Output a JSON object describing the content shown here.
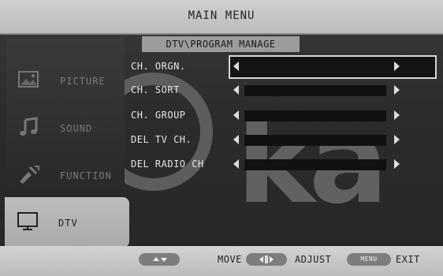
{
  "header": {
    "title": "MAIN MENU",
    "subtitle": "DTV\\PROGRAM MANAGE"
  },
  "sidebar": {
    "items": [
      {
        "label": "PICTURE",
        "icon": "picture-icon",
        "active": false
      },
      {
        "label": "SOUND",
        "icon": "music-note-icon",
        "active": false
      },
      {
        "label": "FUNCTION",
        "icon": "tools-icon",
        "active": false
      },
      {
        "label": "DTV",
        "icon": "tv-icon",
        "active": true
      }
    ]
  },
  "menu": {
    "rows": [
      {
        "label": "CH. ORGN."
      },
      {
        "label": "CH. SORT"
      },
      {
        "label": "CH. GROUP"
      },
      {
        "label": "DEL TV CH."
      },
      {
        "label": "DEL RADIO CH"
      }
    ]
  },
  "footer": {
    "move_label": "MOVE",
    "adjust_label": "ADJUST",
    "menu_key": "MENU",
    "exit_label": "EXIT"
  },
  "colors": {
    "panel": "#2c2c2c",
    "header": "#c7c7c7",
    "active_tab": "#b5b5b5"
  }
}
